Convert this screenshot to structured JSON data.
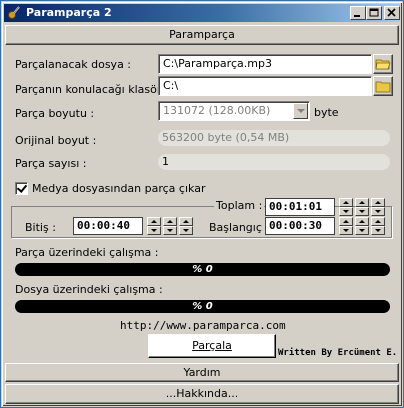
{
  "window": {
    "title": "Paramparça 2"
  },
  "tabs": {
    "top": "Paramparça",
    "help": "Yardım",
    "about": "...Hakkında..."
  },
  "form": {
    "source_label": "Parçalanacak dosya :",
    "source_value": "C:\\Paramparça.mp3",
    "target_label": "Parçanın konulacağı klasör :",
    "target_value": "C:\\",
    "size_label": "Parça boyutu :",
    "size_value": "131072 (128.00KB)",
    "size_unit": "byte",
    "orig_label": "Orijinal boyut :",
    "orig_value": "563200 byte (0,54 MB)",
    "count_label": "Parça sayısı :",
    "count_value": "1",
    "extract_label": "Medya dosyasından parça çıkar"
  },
  "media": {
    "total_label": "Toplam :",
    "total_time": "00:01:01",
    "end_label": "Bitiş :",
    "end_time": "00:00:40",
    "start_label": "Başlangıç :",
    "start_time": "00:00:30"
  },
  "progress": {
    "part_label": "Parça üzerindeki çalışma :",
    "part_text": "% 0",
    "part_value": 0,
    "file_label": "Dosya üzerindeki çalışma :",
    "file_text": "% 0",
    "file_value": 0
  },
  "footer": {
    "url": "http://www.paramparca.com",
    "split_button": "Parçala",
    "credit": "Written By Ercüment E."
  }
}
